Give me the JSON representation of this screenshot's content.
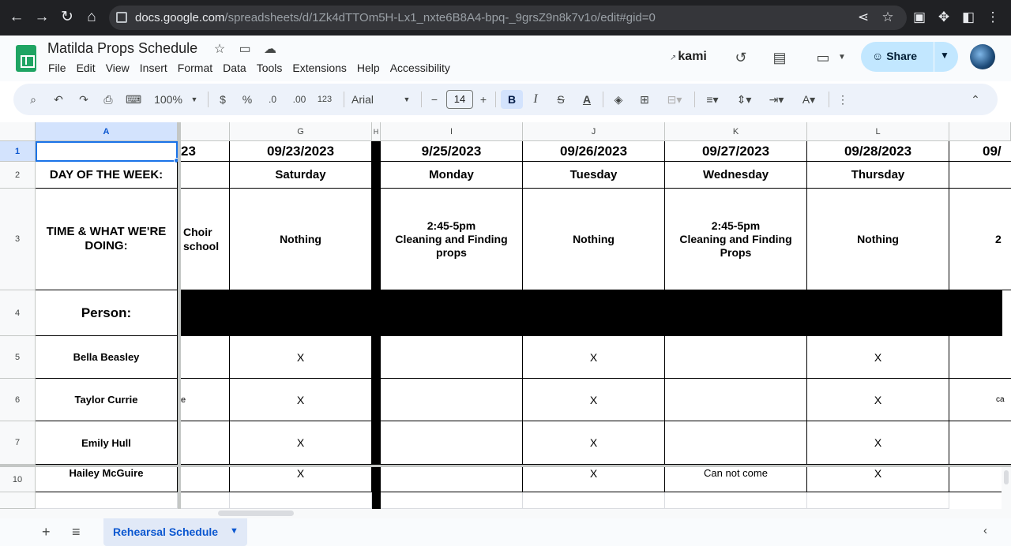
{
  "browser": {
    "url_host": "docs.google.com",
    "url_path": "/spreadsheets/d/1Zk4dTTOm5H-Lx1_nxte6B8A4-bpq-_9grsZ9n8k7v1o/edit#gid=0"
  },
  "header": {
    "title": "Matilda Props Schedule",
    "menu": [
      "File",
      "Edit",
      "View",
      "Insert",
      "Format",
      "Data",
      "Tools",
      "Extensions",
      "Help",
      "Accessibility"
    ],
    "kami": "kami",
    "share_label": "Share"
  },
  "toolbar": {
    "zoom": "100%",
    "currency": "$",
    "percent": "%",
    "dec_decrease": ".0",
    "dec_increase": ".00",
    "number_format": "123",
    "font": "Arial",
    "font_size": "14"
  },
  "columns": {
    "A": "A",
    "G": "G",
    "H": "H",
    "I": "I",
    "J": "J",
    "K": "K",
    "L": "L"
  },
  "rows": {
    "r1": "1",
    "r2": "2",
    "r3": "3",
    "r4": "4",
    "r5": "5",
    "r6": "6",
    "r7": "7",
    "r10": "10"
  },
  "sheet": {
    "a2": "DAY OF THE WEEK:",
    "a3": "TIME & WHAT WE'RE DOING:",
    "a4": "Person:",
    "a5": "Bella Beasley",
    "a6": "Taylor Currie",
    "a7": "Emily Hull",
    "a10": "Hailey McGuire",
    "f1_partial": "23",
    "f3": "Choir school",
    "f6_partial": "e",
    "g1": "09/23/2023",
    "g2": "Saturday",
    "g3": "Nothing",
    "g5": "X",
    "g6": "X",
    "g7": "X",
    "g10": "X",
    "i1": "9/25/2023",
    "i2": "Monday",
    "i3_time": "2:45-5pm",
    "i3_task": "Cleaning and Finding props",
    "j1": "09/26/2023",
    "j2": "Tuesday",
    "j3": "Nothing",
    "j5": "X",
    "j6": "X",
    "j7": "X",
    "j10": "X",
    "k1": "09/27/2023",
    "k2": "Wednesday",
    "k3_time": "2:45-5pm",
    "k3_task": "Cleaning and Finding Props",
    "k10": "Can not come",
    "l1": "09/28/2023",
    "l2": "Thursday",
    "l3": "Nothing",
    "l5": "X",
    "l6": "X",
    "l7": "X",
    "l10": "X",
    "m1_partial": "09/",
    "m3_partial": "2",
    "m6_partial": "ca"
  },
  "tabs": {
    "active": "Rehearsal Schedule"
  },
  "colors": {
    "chrome_bg": "#202124",
    "share_bg": "#c2e7ff",
    "sheets_green": "#1fa463",
    "selection_blue": "#1a73e8"
  }
}
